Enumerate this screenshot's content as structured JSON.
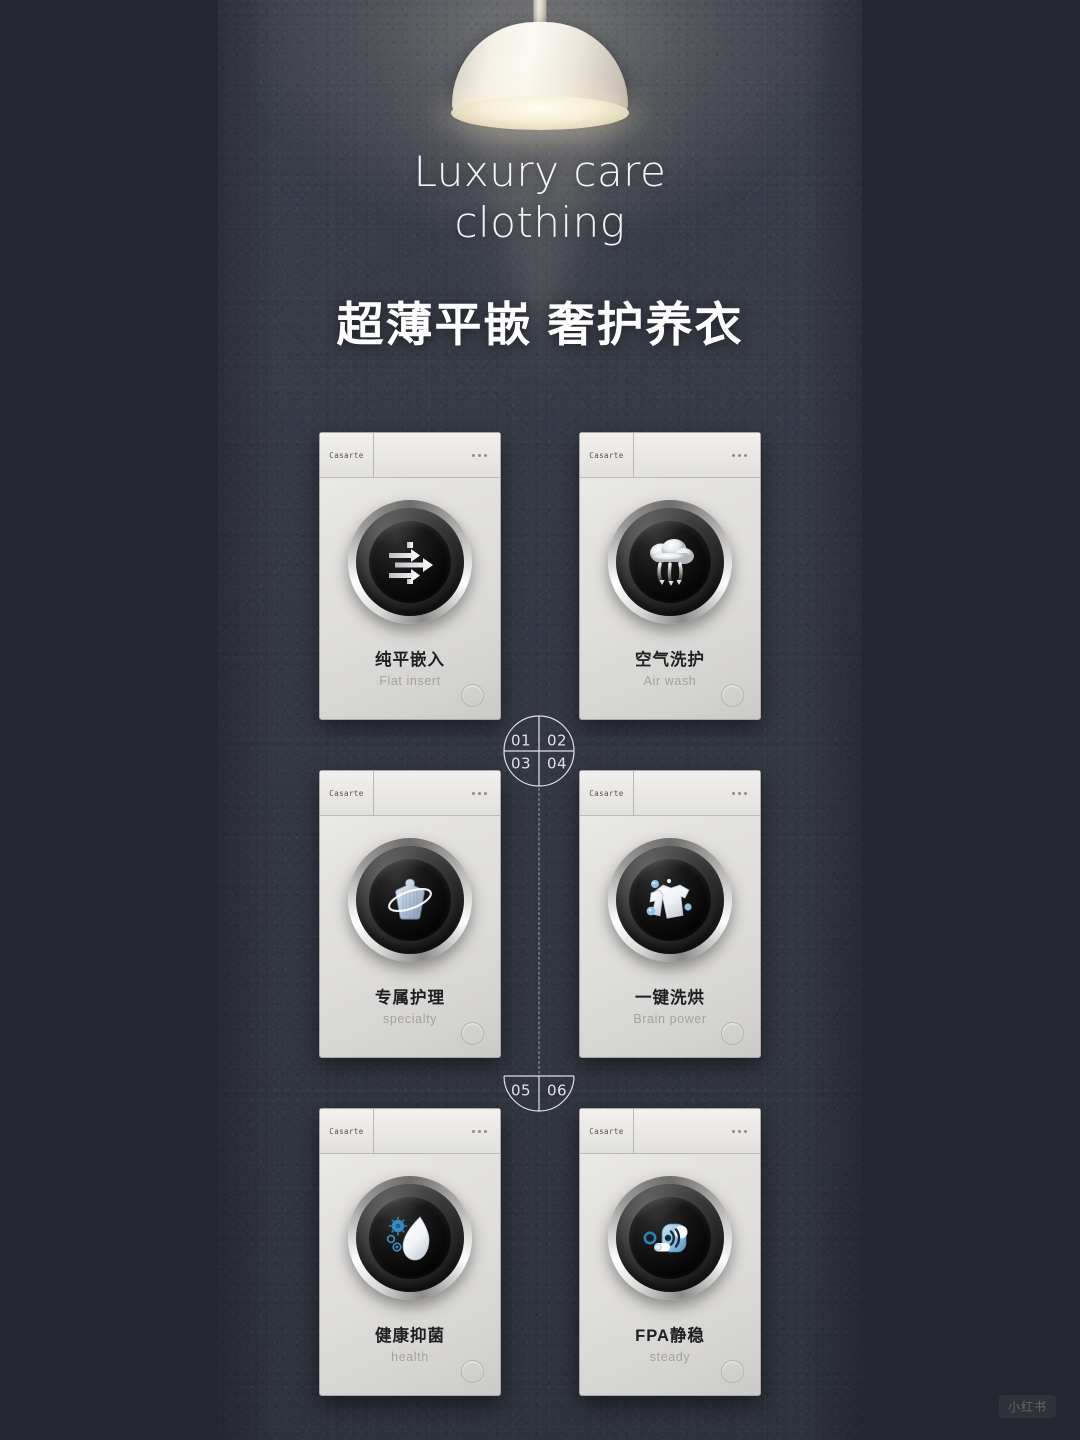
{
  "page": {
    "title_en": [
      "Luxury care",
      "clothing"
    ],
    "title_cn": "超薄平嵌  奢护养衣",
    "watermark": "小红书",
    "bg_color": "#353945",
    "side_color": "#24272f",
    "accent_text": "#ffffff"
  },
  "lamp": {
    "name": "pendant-lamp",
    "glow_color": "#fff7e0"
  },
  "connectors": {
    "top": {
      "numbers": [
        "01",
        "02",
        "03",
        "04"
      ],
      "shape": "full-circle-quadrants"
    },
    "bottom": {
      "numbers": [
        "05",
        "06"
      ],
      "shape": "half-circle-halves"
    }
  },
  "cards": [
    {
      "brand": "Casarte",
      "menu": "...",
      "label_cn": "纯平嵌入",
      "label_en": "Flat insert",
      "icon": "arrows-right-icon",
      "index": "01"
    },
    {
      "brand": "Casarte",
      "menu": "...",
      "label_cn": "空气洗护",
      "label_en": "Air wash",
      "icon": "cloud-airflow-icon",
      "index": "02"
    },
    {
      "brand": "Casarte",
      "menu": "...",
      "label_cn": "专属护理",
      "label_en": "specialty",
      "icon": "sweater-orbit-icon",
      "index": "03"
    },
    {
      "brand": "Casarte",
      "menu": "...",
      "label_cn": "一键洗烘",
      "label_en": "Brain power",
      "icon": "shirt-droplets-icon",
      "index": "04"
    },
    {
      "brand": "Casarte",
      "menu": "...",
      "label_cn": "健康抑菌",
      "label_en": "health",
      "icon": "antibacterial-droplet-icon",
      "index": "05"
    },
    {
      "brand": "Casarte",
      "menu": "...",
      "label_cn": "FPA静稳",
      "label_en": "steady",
      "icon": "quiet-motor-icon",
      "index": "06"
    }
  ]
}
